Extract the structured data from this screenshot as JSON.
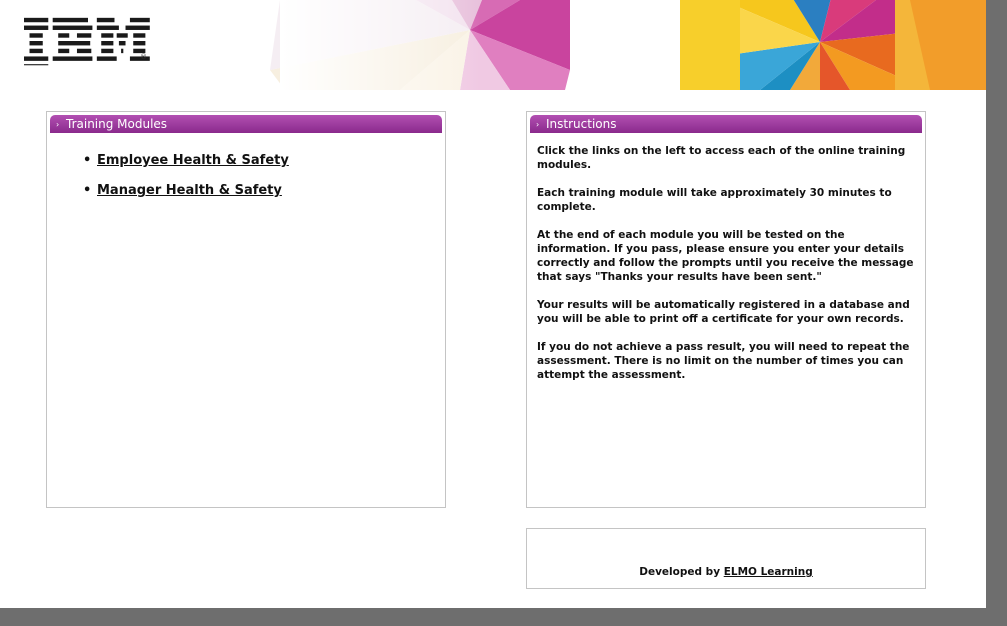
{
  "header": {
    "logo_text": "IBM",
    "registered_mark": "®"
  },
  "training_modules": {
    "title": "Training Modules",
    "items": [
      {
        "label": "Employee Health & Safety"
      },
      {
        "label": "Manager Health & Safety"
      }
    ]
  },
  "instructions": {
    "title": "Instructions",
    "paragraphs": [
      "Click the links on the left to access each of the online training modules.",
      "Each training module will take approximately 30 minutes to complete.",
      "At the end of each module you will be tested on the information. If you pass, please ensure you enter your details correctly and follow the prompts until you receive the message that says \"Thanks your results have been sent.\"",
      "Your results will be automatically registered in a database and you will be able to print off a certificate for your own records.",
      "If you do not achieve a pass result, you will need to repeat the assessment. There is no limit on the number of times you can attempt the assessment."
    ]
  },
  "footer": {
    "developed_by": "Developed by",
    "link_label": "ELMO Learning"
  },
  "icons": {
    "panel_chevron": "chevron-right-icon",
    "list_bullet": "bullet-icon"
  },
  "colors": {
    "panel_header": "#9b3a9d",
    "page_background": "#6e6e6e"
  }
}
